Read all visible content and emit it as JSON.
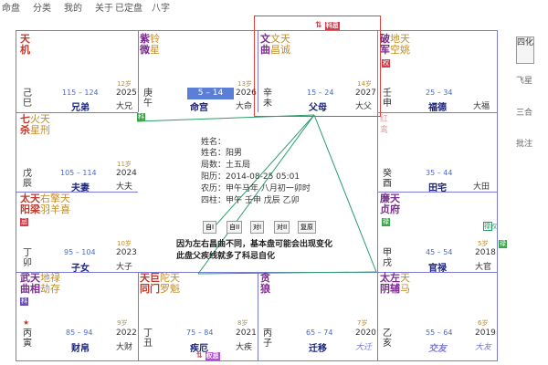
{
  "topbar": {
    "menu": [
      "命盘",
      "分类",
      "我的",
      "关于",
      "已定盘",
      "八字"
    ]
  },
  "side_buttons": [
    "四化",
    "飞星",
    "三合",
    "批注"
  ],
  "palaces": [
    {
      "id": "si",
      "stars_main": [
        "天",
        "机"
      ],
      "stars_minor": [],
      "stem": "己",
      "branch": "巳",
      "range": "115 – 124",
      "year": "2025",
      "palace": "兄弟",
      "sub": "大兄",
      "age": "12岁"
    },
    {
      "id": "wu",
      "stars_main": [
        "紫",
        "微"
      ],
      "stars_minor": [
        "铃",
        "星"
      ],
      "stem": "庚",
      "branch": "午",
      "range": "5 – 14",
      "year": "2026",
      "palace": "命宫",
      "sub": "大命",
      "age": "13岁",
      "badge": "科"
    },
    {
      "id": "wei",
      "stars_main": [
        "文",
        "曲"
      ],
      "stars_minor": [
        "文天",
        "昌诚"
      ],
      "stem": "辛",
      "branch": "未",
      "range": "15 – 24",
      "year": "2027",
      "palace": "父母",
      "sub": "大父",
      "age": "14岁",
      "top_badge": "科忌"
    },
    {
      "id": "shen",
      "stars_main": [
        "破",
        "军"
      ],
      "stars_minor": [
        "地天",
        "空姚"
      ],
      "stem": "壬",
      "branch": "申",
      "range": "25 – 34",
      "year": "",
      "palace": "福德",
      "sub": "大福",
      "age": "",
      "badge_r": "权"
    },
    {
      "id": "chen",
      "stars_main": [
        "七",
        "杀"
      ],
      "stars_minor": [
        "火天",
        "星刑"
      ],
      "stem": "戊",
      "branch": "辰",
      "range": "105 – 114",
      "year": "2024",
      "palace": "夫妻",
      "sub": "大夫",
      "age": "11岁"
    },
    {
      "id": "you",
      "stars_main": [
        "红",
        "鸾"
      ],
      "stars_minor": [],
      "stem": "癸",
      "branch": "酉",
      "range": "35 – 44",
      "year": "",
      "palace": "田宅",
      "sub": "大田",
      "age": ""
    },
    {
      "id": "mao",
      "stars_main": [
        "太天",
        "阳梁"
      ],
      "stars_minor": [
        "右擎天",
        "羽羊喜"
      ],
      "stem": "丁",
      "branch": "卯",
      "range": "95 – 104",
      "year": "2023",
      "palace": "子女",
      "sub": "大子",
      "age": "10岁",
      "badge_r": "忌"
    },
    {
      "id": "xu",
      "stars_main": [
        "廉天",
        "贞府"
      ],
      "stars_minor": [],
      "stem": "甲",
      "branch": "戌",
      "range": "45 – 54",
      "year": "2018",
      "palace": "官禄",
      "sub": "大官",
      "age": "5岁",
      "badge": "禄"
    },
    {
      "id": "yin",
      "stars_main": [
        "武天",
        "曲相"
      ],
      "stars_minor": [
        "地禄",
        "劫存"
      ],
      "stem": "丙",
      "branch": "寅",
      "range": "85 – 94",
      "year": "2022",
      "palace": "财帛",
      "sub": "大财",
      "age": "9岁",
      "badge": "科"
    },
    {
      "id": "chou",
      "stars_main": [
        "天巨",
        "同门"
      ],
      "stars_minor": [
        "陀天",
        "罗魁"
      ],
      "stem": "丁",
      "branch": "丑",
      "range": "75 – 84",
      "year": "2021",
      "palace": "疾厄",
      "sub": "大疾",
      "age": "8岁",
      "badge": "禄"
    },
    {
      "id": "zi",
      "stars_main": [
        "贪",
        "狼"
      ],
      "stars_minor": [],
      "stem": "丙",
      "branch": "子",
      "range": "65 – 74",
      "year": "2020",
      "palace": "迁移",
      "sub": "大迁",
      "age": "7岁"
    },
    {
      "id": "hai",
      "stars_main": [
        "太左",
        "阴辅"
      ],
      "stars_minor": [
        "天",
        "马"
      ],
      "stem": "乙",
      "branch": "亥",
      "range": "55 – 64",
      "year": "2019",
      "palace": "交友",
      "sub": "大友",
      "age": "6岁"
    }
  ],
  "center": {
    "label": "姓名：",
    "name": "姓名：阳男",
    "bureau": "局数：土五局",
    "solar": "阳历：2014-08-25 05:01",
    "lunar": "农历：甲午马年 八月初一卯时",
    "pillars": "四柱：甲午 壬申 戊辰 乙卯",
    "buttons": [
      "自I",
      "自II",
      "对I",
      "对II",
      "复原"
    ],
    "note_line1": "因为左右昌曲不同，基本盘可能会出现变化",
    "note_line2": "此盘父疾线就多了科忌自化"
  },
  "bottom_badges": "权忌",
  "right_badges": "禄权"
}
